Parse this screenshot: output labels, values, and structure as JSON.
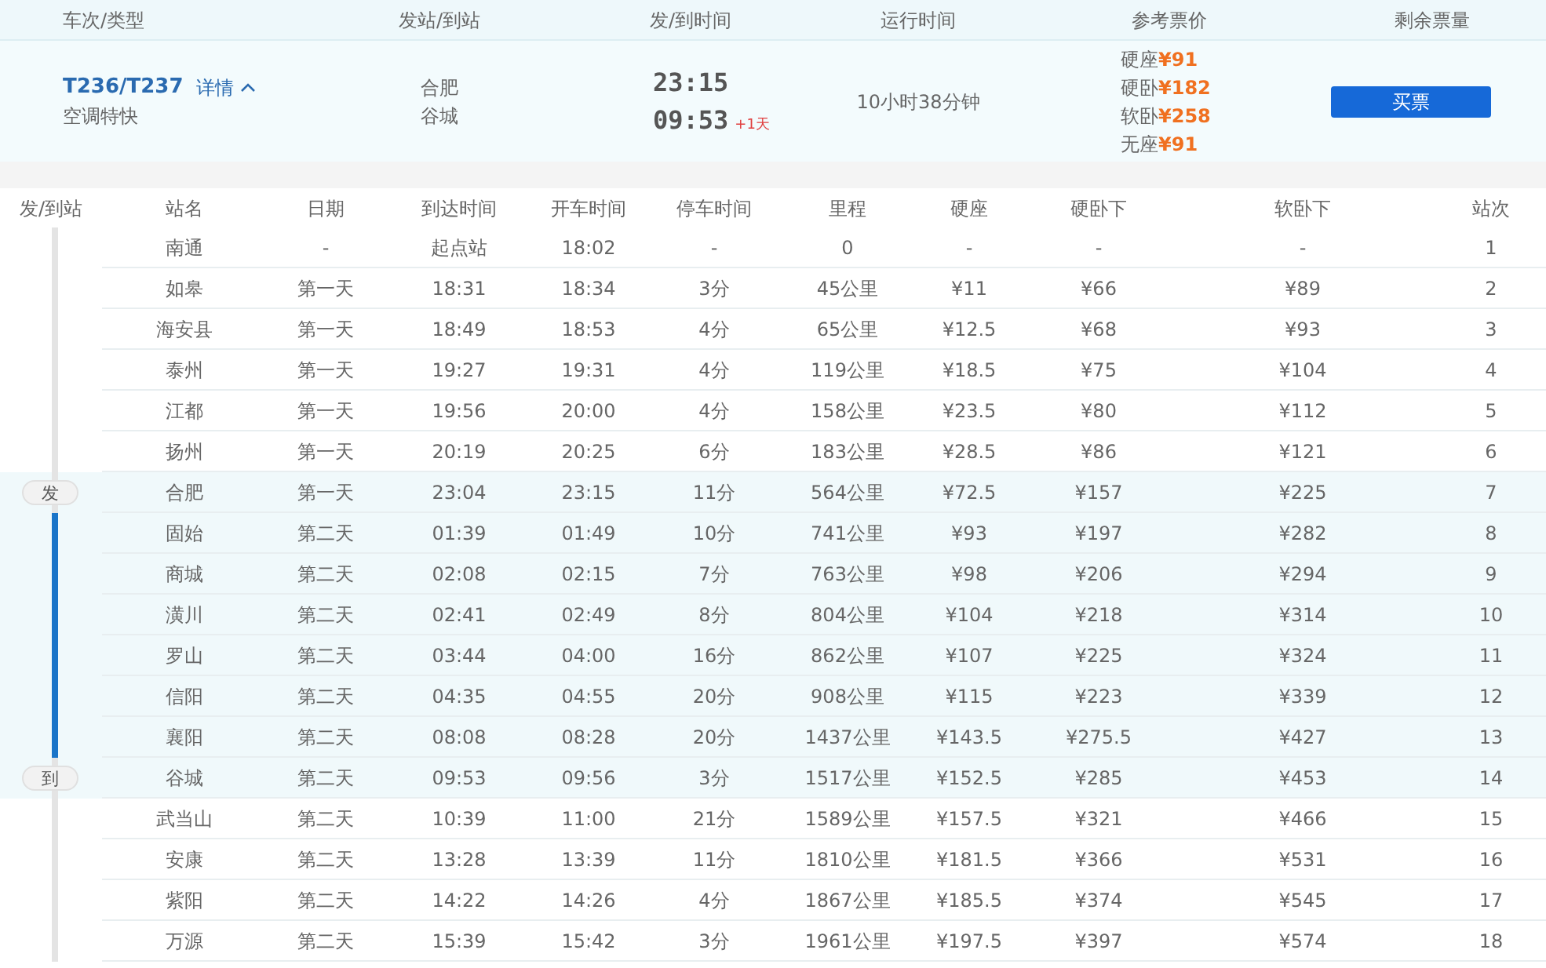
{
  "summary_columns": [
    "车次/类型",
    "发站/到站",
    "发/到时间",
    "运行时间",
    "参考票价",
    "剩余票量"
  ],
  "train": {
    "number": "T236/T237",
    "details_link": "详情",
    "expanded": true,
    "type": "空调特快",
    "from": "合肥",
    "to": "谷城",
    "depart": "23:15",
    "arrive": "09:53",
    "day_offset": "+1天",
    "duration": "10小时38分钟",
    "prices": [
      {
        "seat": "硬座",
        "price": "¥91"
      },
      {
        "seat": "硬卧",
        "price": "¥182"
      },
      {
        "seat": "软卧",
        "price": "¥258"
      },
      {
        "seat": "无座",
        "price": "¥91"
      }
    ],
    "buy_button": "买票"
  },
  "stop_columns": [
    "发/到站",
    "站名",
    "日期",
    "到达时间",
    "开车时间",
    "停车时间",
    "里程",
    "硬座",
    "硬卧下",
    "软卧下",
    "站次"
  ],
  "stops": [
    {
      "station": "南通",
      "date": "-",
      "arrive": "起点站",
      "depart": "18:02",
      "stop": "-",
      "distance": "0",
      "hard_seat": "-",
      "hard_sleeper": "-",
      "soft_sleeper": "-",
      "seq": "1",
      "on_route": false
    },
    {
      "station": "如皋",
      "date": "第一天",
      "arrive": "18:31",
      "depart": "18:34",
      "stop": "3分",
      "distance": "45公里",
      "hard_seat": "¥11",
      "hard_sleeper": "¥66",
      "soft_sleeper": "¥89",
      "seq": "2",
      "on_route": false
    },
    {
      "station": "海安县",
      "date": "第一天",
      "arrive": "18:49",
      "depart": "18:53",
      "stop": "4分",
      "distance": "65公里",
      "hard_seat": "¥12.5",
      "hard_sleeper": "¥68",
      "soft_sleeper": "¥93",
      "seq": "3",
      "on_route": false
    },
    {
      "station": "泰州",
      "date": "第一天",
      "arrive": "19:27",
      "depart": "19:31",
      "stop": "4分",
      "distance": "119公里",
      "hard_seat": "¥18.5",
      "hard_sleeper": "¥75",
      "soft_sleeper": "¥104",
      "seq": "4",
      "on_route": false
    },
    {
      "station": "江都",
      "date": "第一天",
      "arrive": "19:56",
      "depart": "20:00",
      "stop": "4分",
      "distance": "158公里",
      "hard_seat": "¥23.5",
      "hard_sleeper": "¥80",
      "soft_sleeper": "¥112",
      "seq": "5",
      "on_route": false
    },
    {
      "station": "扬州",
      "date": "第一天",
      "arrive": "20:19",
      "depart": "20:25",
      "stop": "6分",
      "distance": "183公里",
      "hard_seat": "¥28.5",
      "hard_sleeper": "¥86",
      "soft_sleeper": "¥121",
      "seq": "6",
      "on_route": false
    },
    {
      "marker": "发",
      "station": "合肥",
      "date": "第一天",
      "arrive": "23:04",
      "depart": "23:15",
      "stop": "11分",
      "distance": "564公里",
      "hard_seat": "¥72.5",
      "hard_sleeper": "¥157",
      "soft_sleeper": "¥225",
      "seq": "7",
      "on_route": true
    },
    {
      "station": "固始",
      "date": "第二天",
      "arrive": "01:39",
      "depart": "01:49",
      "stop": "10分",
      "distance": "741公里",
      "hard_seat": "¥93",
      "hard_sleeper": "¥197",
      "soft_sleeper": "¥282",
      "seq": "8",
      "on_route": true
    },
    {
      "station": "商城",
      "date": "第二天",
      "arrive": "02:08",
      "depart": "02:15",
      "stop": "7分",
      "distance": "763公里",
      "hard_seat": "¥98",
      "hard_sleeper": "¥206",
      "soft_sleeper": "¥294",
      "seq": "9",
      "on_route": true
    },
    {
      "station": "潢川",
      "date": "第二天",
      "arrive": "02:41",
      "depart": "02:49",
      "stop": "8分",
      "distance": "804公里",
      "hard_seat": "¥104",
      "hard_sleeper": "¥218",
      "soft_sleeper": "¥314",
      "seq": "10",
      "on_route": true
    },
    {
      "station": "罗山",
      "date": "第二天",
      "arrive": "03:44",
      "depart": "04:00",
      "stop": "16分",
      "distance": "862公里",
      "hard_seat": "¥107",
      "hard_sleeper": "¥225",
      "soft_sleeper": "¥324",
      "seq": "11",
      "on_route": true
    },
    {
      "station": "信阳",
      "date": "第二天",
      "arrive": "04:35",
      "depart": "04:55",
      "stop": "20分",
      "distance": "908公里",
      "hard_seat": "¥115",
      "hard_sleeper": "¥223",
      "soft_sleeper": "¥339",
      "seq": "12",
      "on_route": true
    },
    {
      "station": "襄阳",
      "date": "第二天",
      "arrive": "08:08",
      "depart": "08:28",
      "stop": "20分",
      "distance": "1437公里",
      "hard_seat": "¥143.5",
      "hard_sleeper": "¥275.5",
      "soft_sleeper": "¥427",
      "seq": "13",
      "on_route": true
    },
    {
      "marker": "到",
      "station": "谷城",
      "date": "第二天",
      "arrive": "09:53",
      "depart": "09:56",
      "stop": "3分",
      "distance": "1517公里",
      "hard_seat": "¥152.5",
      "hard_sleeper": "¥285",
      "soft_sleeper": "¥453",
      "seq": "14",
      "on_route": true
    },
    {
      "station": "武当山",
      "date": "第二天",
      "arrive": "10:39",
      "depart": "11:00",
      "stop": "21分",
      "distance": "1589公里",
      "hard_seat": "¥157.5",
      "hard_sleeper": "¥321",
      "soft_sleeper": "¥466",
      "seq": "15",
      "on_route": false
    },
    {
      "station": "安康",
      "date": "第二天",
      "arrive": "13:28",
      "depart": "13:39",
      "stop": "11分",
      "distance": "1810公里",
      "hard_seat": "¥181.5",
      "hard_sleeper": "¥366",
      "soft_sleeper": "¥531",
      "seq": "16",
      "on_route": false
    },
    {
      "station": "紫阳",
      "date": "第二天",
      "arrive": "14:22",
      "depart": "14:26",
      "stop": "4分",
      "distance": "1867公里",
      "hard_seat": "¥185.5",
      "hard_sleeper": "¥374",
      "soft_sleeper": "¥545",
      "seq": "17",
      "on_route": false
    },
    {
      "station": "万源",
      "date": "第二天",
      "arrive": "15:39",
      "depart": "15:42",
      "stop": "3分",
      "distance": "1961公里",
      "hard_seat": "¥197.5",
      "hard_sleeper": "¥397",
      "soft_sleeper": "¥574",
      "seq": "18",
      "on_route": false
    }
  ]
}
